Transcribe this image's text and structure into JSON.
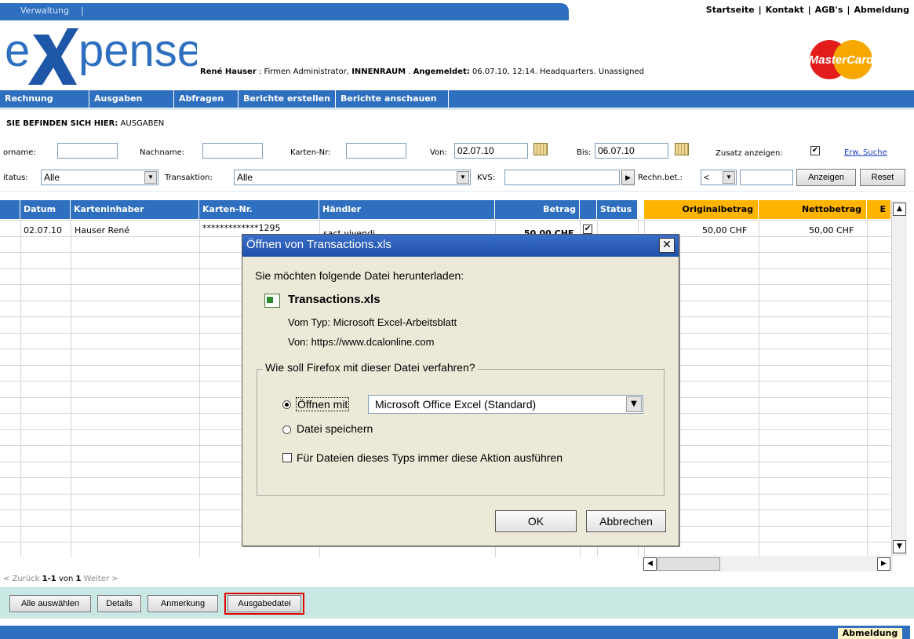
{
  "top": {
    "section": "Verwaltung",
    "links": [
      "Startseite",
      "Kontakt",
      "AGB's",
      "Abmeldung"
    ]
  },
  "logo": {
    "text": "eXpense",
    "card_brand": "MasterCard"
  },
  "user": {
    "name": "René Hauser",
    "role": " : Firmen Administrator, ",
    "company": "INNENRAUM",
    "sep": " . ",
    "login_label": "Angemeldet:",
    "login_info": " 06.07.10, 12:14. Headquarters. Unassigned"
  },
  "menu": [
    "Rechnung",
    "Ausgaben",
    "Abfragen",
    "Berichte erstellen",
    "Berichte anschauen"
  ],
  "breadcrumb": {
    "label": "SIE BEFINDEN SICH HIER:",
    "page": " AUSGABEN"
  },
  "filters": {
    "vorname_label": "orname:",
    "nachname_label": "Nachname:",
    "karten_label": "Karten-Nr:",
    "von_label": "Von:",
    "von_value": "02.07.10",
    "bis_label": "Bis:",
    "bis_value": "06.07.10",
    "zusatz_label": "Zusatz anzeigen:",
    "erw_suche": "Erw. Suche",
    "status_label": "itatus:",
    "status_value": "Alle",
    "transaktion_label": "Transaktion:",
    "transaktion_value": "Alle",
    "kvs_label": "KVS:",
    "rechn_label": "Rechn.bet.:",
    "rechn_op": "<",
    "anzeigen": "Anzeigen",
    "reset": "Reset"
  },
  "table": {
    "headers": [
      "Datum",
      "Karteninhaber",
      "Karten-Nr.",
      "Händler",
      "Betrag",
      "Status",
      "Originalbetrag",
      "Nettobetrag",
      "E"
    ],
    "row": {
      "datum": "02.07.10",
      "inhaber": "Hauser René",
      "karte": "*************1295",
      "haendler": "sact vivendi",
      "betrag": "50,00 CHF",
      "original": "50,00 CHF",
      "netto": "50,00 CHF"
    }
  },
  "pager": {
    "prev": "< Zurück",
    "range": "1-1",
    "of": "von",
    "total": "1",
    "next": "Weiter >"
  },
  "actions": [
    "Alle auswählen",
    "Details",
    "Anmerkung",
    "Ausgabedatei"
  ],
  "footer": {
    "logout": "Abmeldung"
  },
  "dialog": {
    "title": "Öffnen von Transactions.xls",
    "intro": "Sie möchten folgende Datei herunterladen:",
    "filename": "Transactions.xls",
    "type_line": "Vom Typ: Microsoft Excel-Arbeitsblatt",
    "from_line": "Von: https://www.dcalonline.com",
    "question": "Wie soll Firefox mit dieser Datei verfahren?",
    "open_with": "Öffnen mit",
    "open_with_app": "Microsoft Office Excel (Standard)",
    "save_file": "Datei speichern",
    "always": "Für Dateien dieses Typs immer diese Aktion ausführen",
    "ok": "OK",
    "cancel": "Abbrechen"
  },
  "colors": {
    "blue": "#2f6fbf",
    "orange": "#ffb400",
    "band": "#c9e7e3",
    "highlight": "#e00000"
  }
}
